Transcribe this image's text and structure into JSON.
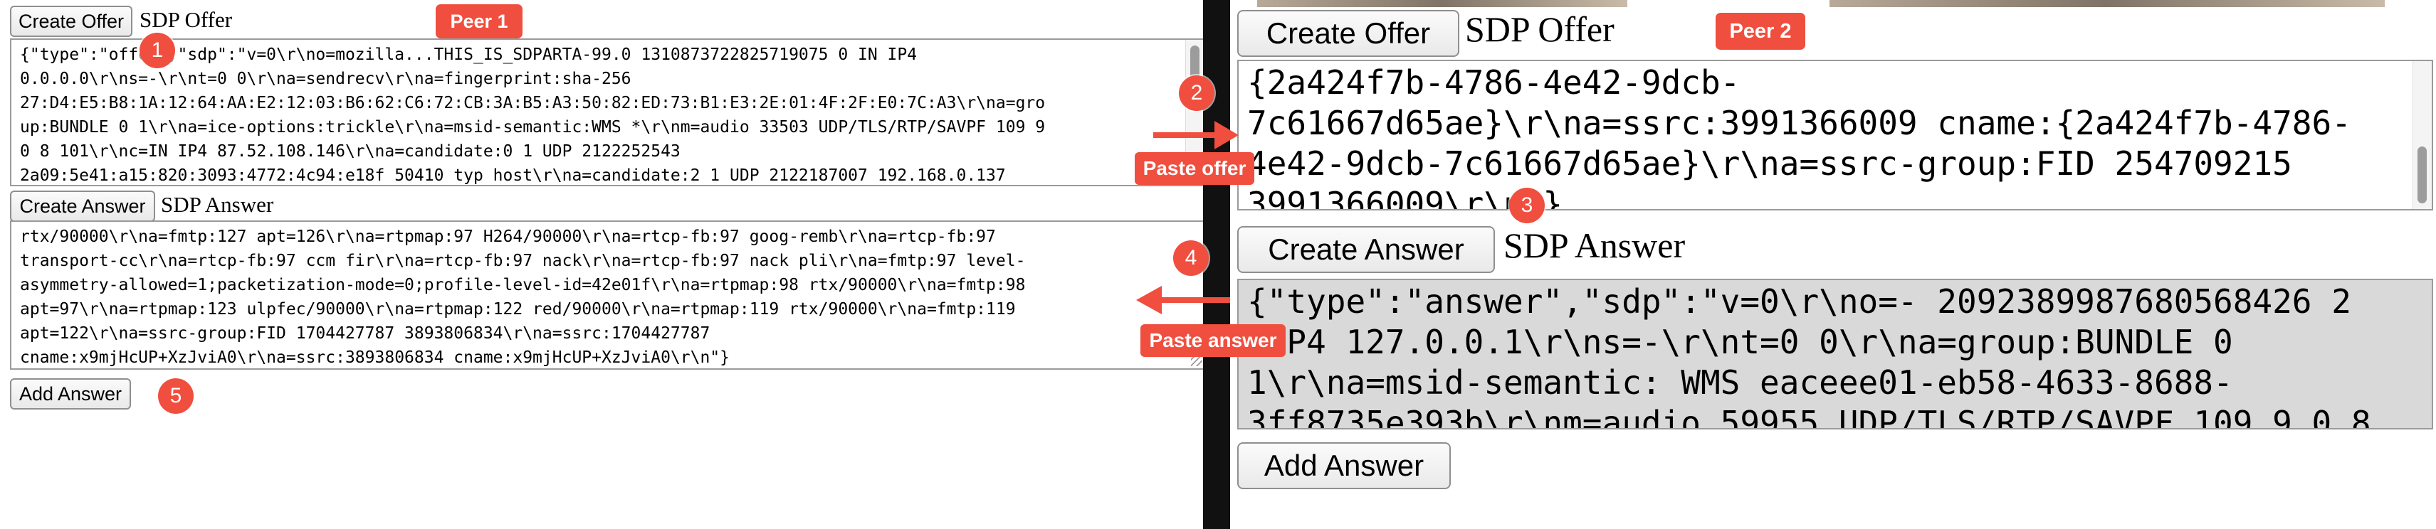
{
  "colors": {
    "accent": "#f04e3e",
    "divider": "#111111"
  },
  "left": {
    "create_offer": "Create Offer",
    "sdp_offer_label": "SDP Offer",
    "offer_text": "{\"type\":\"offer\",\"sdp\":\"v=0\\r\\no=mozilla...THIS_IS_SDPARTA-99.0 1310873722825719075 0 IN IP4\n0.0.0.0\\r\\ns=-\\r\\nt=0 0\\r\\na=sendrecv\\r\\na=fingerprint:sha-256\n27:D4:E5:B8:1A:12:64:AA:E2:12:03:B6:62:C6:72:CB:3A:B5:A3:50:82:ED:73:B1:E3:2E:01:4F:2F:E0:7C:A3\\r\\na=gro\nup:BUNDLE 0 1\\r\\na=ice-options:trickle\\r\\na=msid-semantic:WMS *\\r\\nm=audio 33503 UDP/TLS/RTP/SAVPF 109 9\n0 8 101\\r\\nc=IN IP4 87.52.108.146\\r\\na=candidate:0 1 UDP 2122252543\n2a09:5e41:a15:820:3093:4772:4c94:e18f 50410 typ host\\r\\na=candidate:2 1 UDP 2122187007 192.168.0.137",
    "create_answer": "Create Answer",
    "sdp_answer_label": "SDP Answer",
    "answer_text": "rtx/90000\\r\\na=fmtp:127 apt=126\\r\\na=rtpmap:97 H264/90000\\r\\na=rtcp-fb:97 goog-remb\\r\\na=rtcp-fb:97\ntransport-cc\\r\\na=rtcp-fb:97 ccm fir\\r\\na=rtcp-fb:97 nack\\r\\na=rtcp-fb:97 nack pli\\r\\na=fmtp:97 level-\nasymmetry-allowed=1;packetization-mode=0;profile-level-id=42e01f\\r\\na=rtpmap:98 rtx/90000\\r\\na=fmtp:98\napt=97\\r\\na=rtpmap:123 ulpfec/90000\\r\\na=rtpmap:122 red/90000\\r\\na=rtpmap:119 rtx/90000\\r\\na=fmtp:119\napt=122\\r\\na=ssrc-group:FID 1704427787 3893806834\\r\\na=ssrc:1704427787\ncname:x9mjHcUP+XzJviA0\\r\\na=ssrc:3893806834 cname:x9mjHcUP+XzJviA0\\r\\n\"}",
    "add_answer": "Add Answer"
  },
  "right": {
    "create_offer": "Create Offer",
    "sdp_offer_label": "SDP Offer",
    "offer_text": "{2a424f7b-4786-4e42-9dcb-\n7c61667d65ae}\\r\\na=ssrc:3991366009 cname:{2a424f7b-4786-\n4e42-9dcb-7c61667d65ae}\\r\\na=ssrc-group:FID 254709215\n3991366009\\r\\n\"}",
    "create_answer": "Create Answer",
    "sdp_answer_label": "SDP Answer",
    "answer_text": "{\"type\":\"answer\",\"sdp\":\"v=0\\r\\no=- 2092389987680568426 2\n IP4 127.0.0.1\\r\\ns=-\\r\\nt=0 0\\r\\na=group:BUNDLE 0\n1\\r\\na=msid-semantic: WMS eaceee01-eb58-4633-8688-\n3ff8735e393b\\r\\nm=audio 59955 UDP/TLS/RTP/SAVPF 109 9 0 8",
    "add_answer": "Add Answer"
  },
  "annotations": {
    "peer1": "Peer 1",
    "peer2": "Peer 2",
    "paste_offer": "Paste offer",
    "paste_answer": "Paste answer",
    "steps": [
      "1",
      "2",
      "3",
      "4",
      "5"
    ]
  }
}
